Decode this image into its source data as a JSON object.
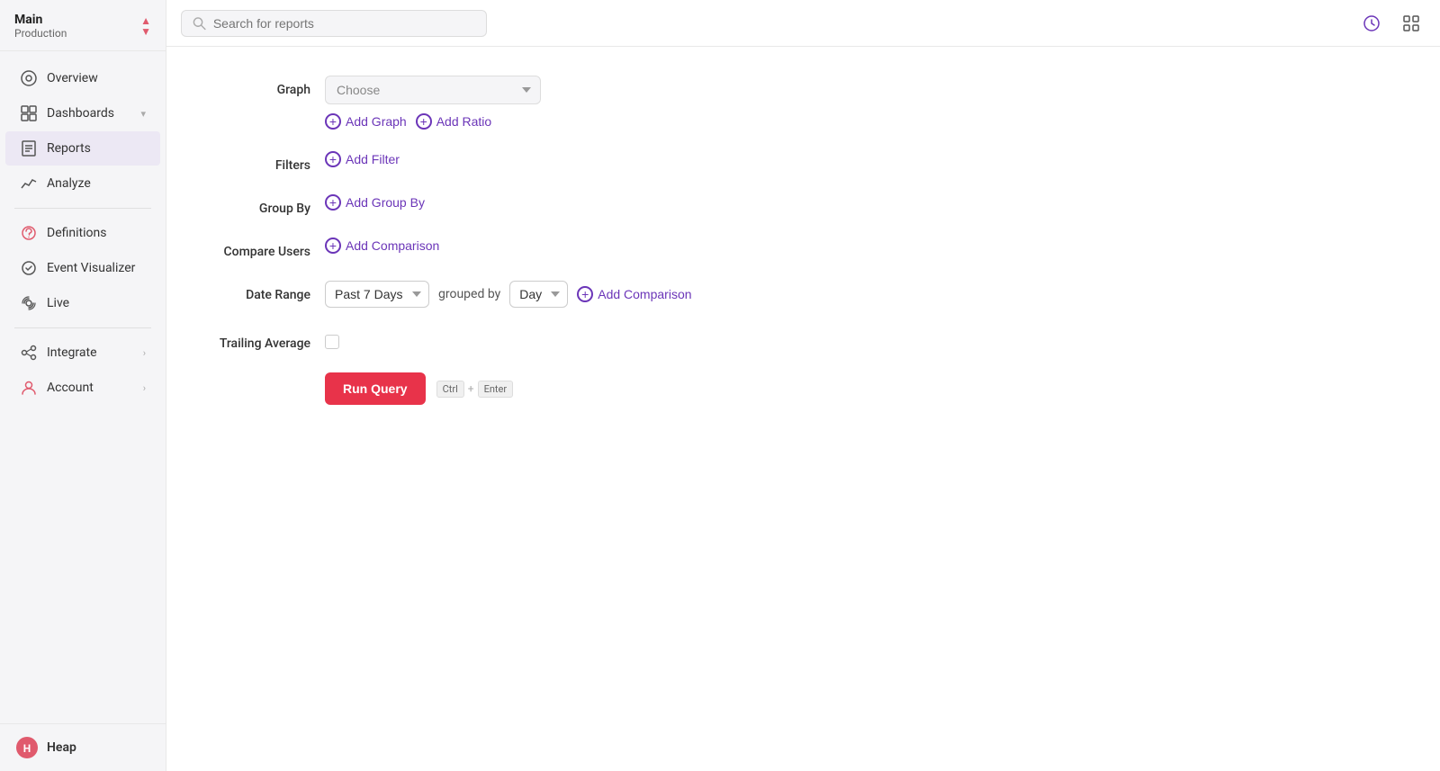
{
  "sidebar": {
    "header": {
      "main": "Main",
      "sub": "Production"
    },
    "nav_items": [
      {
        "id": "overview",
        "label": "Overview",
        "icon": "overview-icon",
        "arrow": false
      },
      {
        "id": "dashboards",
        "label": "Dashboards",
        "icon": "dashboards-icon",
        "arrow": true
      },
      {
        "id": "reports",
        "label": "Reports",
        "icon": "reports-icon",
        "arrow": false
      },
      {
        "id": "analyze",
        "label": "Analyze",
        "icon": "analyze-icon",
        "arrow": false
      },
      {
        "id": "definitions",
        "label": "Definitions",
        "icon": "definitions-icon",
        "arrow": false
      },
      {
        "id": "event-visualizer",
        "label": "Event Visualizer",
        "icon": "event-visualizer-icon",
        "arrow": false
      },
      {
        "id": "live",
        "label": "Live",
        "icon": "live-icon",
        "arrow": false
      },
      {
        "id": "integrate",
        "label": "Integrate",
        "icon": "integrate-icon",
        "arrow": true
      },
      {
        "id": "account",
        "label": "Account",
        "icon": "account-icon",
        "arrow": true
      }
    ],
    "footer": {
      "brand": "Heap"
    }
  },
  "topbar": {
    "search_placeholder": "Search for reports"
  },
  "form": {
    "graph_label": "Graph",
    "graph_placeholder": "Choose",
    "add_graph_label": "Add Graph",
    "add_ratio_label": "Add Ratio",
    "filters_label": "Filters",
    "add_filter_label": "Add Filter",
    "group_by_label": "Group By",
    "add_group_by_label": "Add Group By",
    "compare_users_label": "Compare Users",
    "add_comparison_label": "Add Comparison",
    "date_range_label": "Date Range",
    "date_range_value": "Past 7 Days",
    "grouped_by_text": "grouped by",
    "day_value": "Day",
    "add_comparison_date_label": "Add Comparison",
    "trailing_average_label": "Trailing Average",
    "run_query_label": "Run Query",
    "keyboard_ctrl": "Ctrl",
    "keyboard_plus": "+",
    "keyboard_enter": "Enter"
  }
}
